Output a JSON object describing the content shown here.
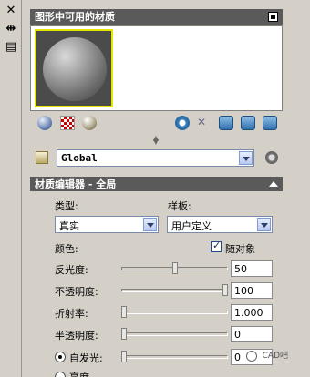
{
  "title": "图形中可用的材质",
  "toolstrip": {
    "close_glyph": "✕",
    "pin_glyph": "⇹",
    "props_glyph": "▤"
  },
  "icons": [
    "sphere-preview-icon",
    "checker-background-icon",
    "material-sphere-icon",
    "create-material-icon",
    "purge-icon",
    "sync-icon",
    "apply-icon",
    "select-objects-icon"
  ],
  "library": {
    "value": "Global"
  },
  "editor": {
    "header": "材质编辑器 - 全局",
    "type_label": "类型:",
    "type_value": "真实",
    "template_label": "样板:",
    "template_value": "用户定义",
    "color_label": "颜色:",
    "by_object_label": "随对象",
    "by_object_checked": true,
    "rows": [
      {
        "label": "反光度:",
        "value": "50",
        "level": 0.5
      },
      {
        "label": "不透明度:",
        "value": "100",
        "level": 1.0
      },
      {
        "label": "折射率:",
        "value": "1.000",
        "level": 0.0
      },
      {
        "label": "半透明度:",
        "value": "0",
        "level": 0.0
      },
      {
        "label": "自发光:",
        "value": "0",
        "level": 0.0
      }
    ],
    "luminance_label": "亮度"
  },
  "watermark": "CAD吧"
}
